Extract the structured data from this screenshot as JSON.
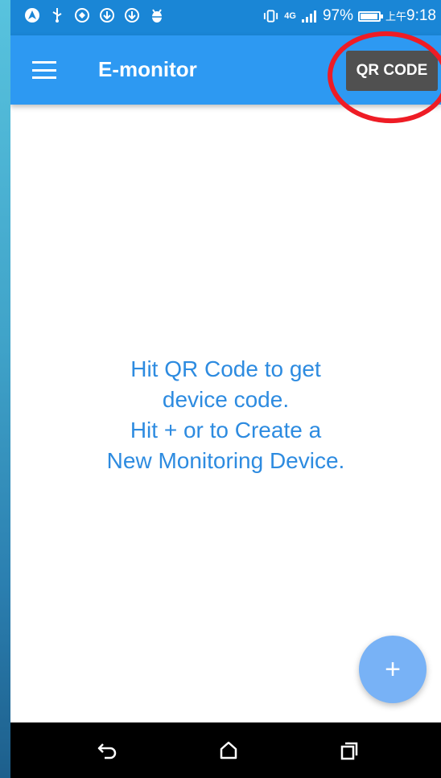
{
  "status_bar": {
    "battery_percent": "97%",
    "battery_level": 0.97,
    "time_prefix": "上午",
    "time": "9:18",
    "network_label": "4G",
    "left_icons": [
      "navigation-icon",
      "usb-icon",
      "sync-icon",
      "download-icon",
      "download-icon",
      "android-debug-icon"
    ],
    "right_icons": [
      "vibrate-icon",
      "network-type-icon",
      "signal-icon",
      "battery-icon"
    ]
  },
  "app_bar": {
    "title": "E-monitor",
    "menu_icon": "hamburger-menu-icon",
    "qr_button_label": "QR CODE",
    "background_color": "#2d99f2"
  },
  "main": {
    "empty_message_lines": [
      "Hit QR Code to get",
      "device code.",
      "Hit + or to Create a",
      "New Monitoring Device."
    ],
    "text_color": "#2d8be0"
  },
  "fab": {
    "label": "+",
    "icon": "add-icon",
    "color": "#78b2f6"
  },
  "annotation": {
    "shape": "red-ellipse-highlight",
    "target": "qr-code-button",
    "color": "#ee1c25"
  },
  "navigation_bar": {
    "buttons": [
      "back-icon",
      "home-icon",
      "recent-apps-icon"
    ]
  }
}
